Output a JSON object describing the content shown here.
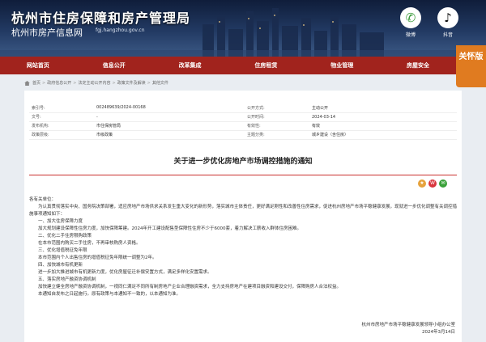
{
  "header": {
    "title": "杭州市住房保障和房产管理局",
    "subtitle": "杭州市房产信息网",
    "url": "fgj.hangzhou.gov.cn",
    "qr_weibo_label": "微博",
    "qr_douyin_label": "抖音"
  },
  "nav": {
    "items": [
      "网站首页",
      "信息公开",
      "改革集成",
      "住房租赁",
      "物业管理",
      "房屋安全"
    ],
    "elder_label": "关怀版"
  },
  "breadcrumb": [
    "首页",
    "政府信息公开",
    "法定主动公开内容",
    "政策文件及解读",
    "其他文件"
  ],
  "meta": {
    "rows": [
      {
        "k1": "索引号:",
        "v1": "002489639/2024-00168",
        "k2": "公开方式:",
        "v2": "主动公开"
      },
      {
        "k1": "文号:",
        "v1": "-",
        "k2": "公开时间:",
        "v2": "2024-03-14"
      },
      {
        "k1": "发布机构:",
        "v1": "市住保房管局",
        "k2": "有效性:",
        "v2": "有效"
      },
      {
        "k1": "政策层级:",
        "v1": "市级政策",
        "k2": "主题分类:",
        "v2": "城乡建设（含住房）"
      }
    ]
  },
  "document": {
    "title": "关于进一步优化房地产市场调控措施的通知",
    "greeting": "各有关单位：",
    "paragraphs": [
      "为认真贯彻落实中央、国务院决策部署，适应房地产市场供求关系发生重大变化的新形势，落实城市主体责任，更好满足刚性和改善性住房需求，促进杭州房地产市场平稳健康发展，现就进一步优化调整有关调控措施事项通知如下：",
      "一、加大住房保障力度",
      "加大规划建设保障性住房力度，加快保障筹建。2024年开工建设配售型保障性住房不少于6000套，着力解决工薪收入群体住房困难。",
      "二、优化二手住房限购政策",
      "在本市范围内购买二手住房，不再审核购房人资格。",
      "三、优化增值税征免年限",
      "本市范围内个人出售住房的增值税征免年限统一调整为2年。",
      "四、加快城市有机更新",
      "进一步加大推进城市有机更新力度，优化房屋征迁补偿安置方式，满足多样化安置需求。",
      "五、落实房地产融资协调机制",
      "加快建立健全房地产融资协调机制，一视同仁满足不同所有制房地产企业合理融资需求，全力支持房地产在建项目融资和建设交付，保障购房人合法权益。",
      "本通知自发布之日起施行。原有政策与本通知不一致的，以本通知为准。"
    ],
    "signature": "杭州市房地产市场平稳健康发展领导小组办公室",
    "date": "2024年3月14日"
  },
  "colors": {
    "nav": "#a1231d",
    "elder": "#e07b20",
    "divider": "#c9302c"
  }
}
